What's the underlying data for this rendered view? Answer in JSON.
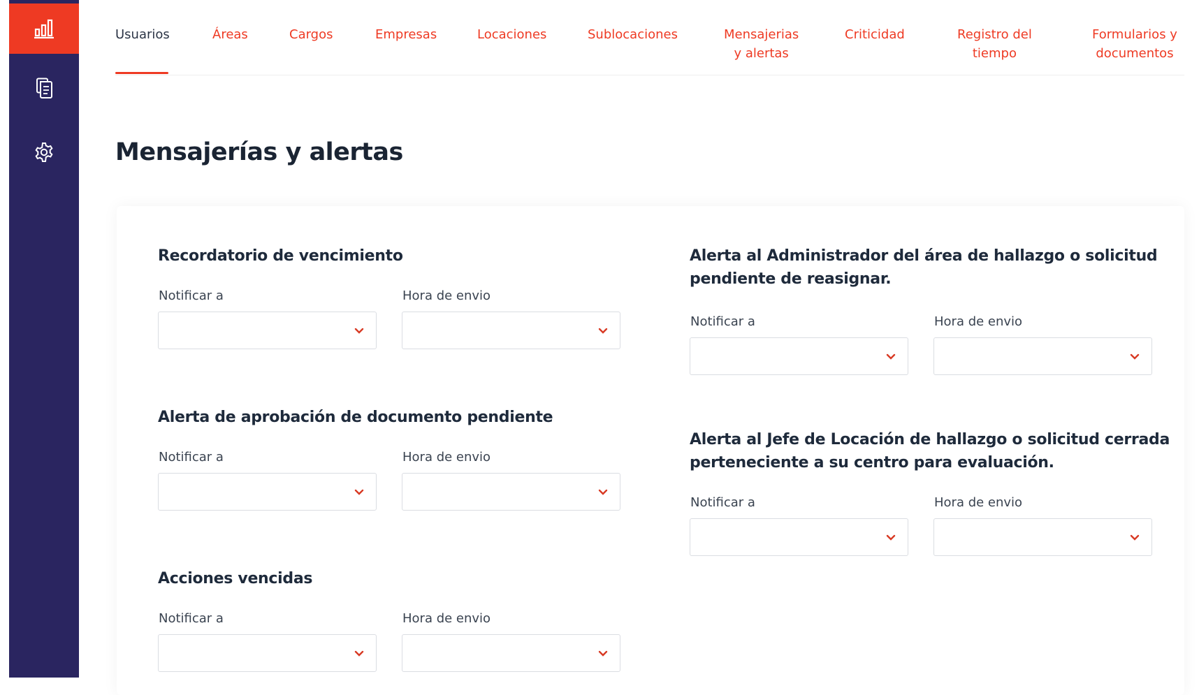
{
  "brand": {
    "accent": "#ee3a23",
    "sidebar_bg": "#2a2560"
  },
  "sidebar": {
    "items": [
      {
        "icon": "bar-chart-icon",
        "active": true
      },
      {
        "icon": "documents-icon"
      },
      {
        "icon": "gear-icon"
      }
    ]
  },
  "tabs": [
    {
      "label": "Usuarios",
      "active": true
    },
    {
      "label": "Áreas"
    },
    {
      "label": "Cargos"
    },
    {
      "label": "Empresas"
    },
    {
      "label": "Locaciones"
    },
    {
      "label": "Sublocaciones"
    },
    {
      "label": "Mensajerias\ny alertas"
    },
    {
      "label": "Criticidad"
    },
    {
      "label": "Registro del\ntiempo"
    },
    {
      "label": "Formularios y\ndocumentos"
    }
  ],
  "page": {
    "title": "Mensajerías y alertas"
  },
  "sections": [
    {
      "title": "Recordatorio de vencimiento",
      "notify_label": "Notificar a",
      "notify_value": "",
      "time_label": "Hora de envio",
      "time_value": ""
    },
    {
      "title": "Alerta de aprobación de documento pendiente",
      "notify_label": "Notificar a",
      "notify_value": "",
      "time_label": "Hora de envio",
      "time_value": ""
    },
    {
      "title": "Acciones vencidas",
      "notify_label": "Notificar a",
      "notify_value": "",
      "time_label": "Hora de envio",
      "time_value": ""
    },
    {
      "title": "Alerta al Administrador del área de hallazgo o solicitud\npendiente de reasignar.",
      "notify_label": "Notificar a",
      "notify_value": "",
      "time_label": "Hora de envio",
      "time_value": ""
    },
    {
      "title": "Alerta al Jefe de Locación de hallazgo o solicitud cerrada\nperteneciente a su centro para evaluación.",
      "notify_label": "Notificar a",
      "notify_value": "",
      "time_label": "Hora de envio",
      "time_value": ""
    }
  ]
}
